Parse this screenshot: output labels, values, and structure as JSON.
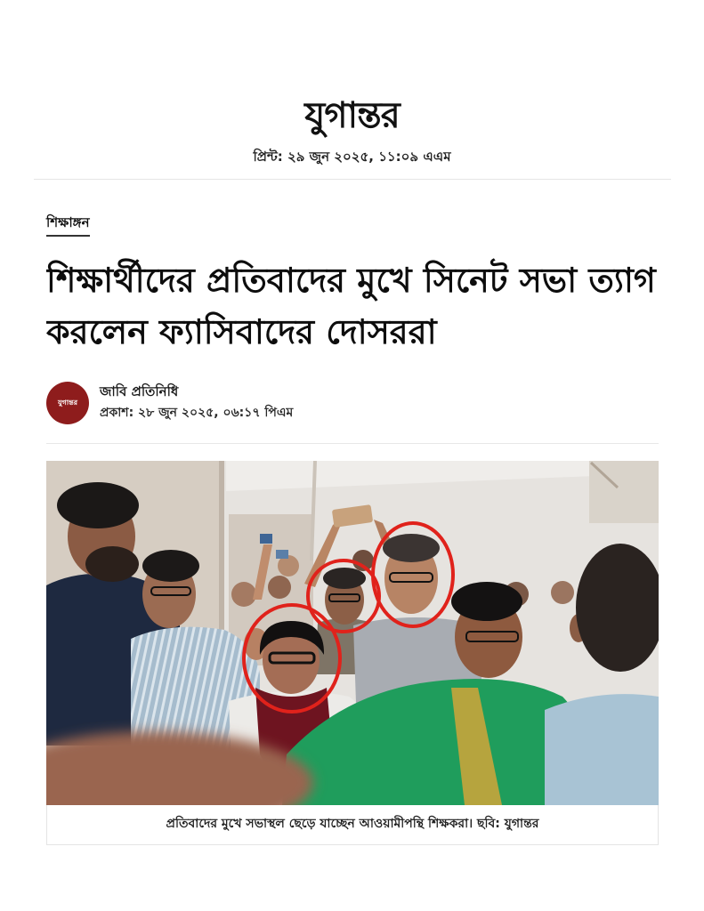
{
  "masthead": {
    "logo_text": "যুগান্তর",
    "print_timestamp": "প্রিন্ট: ২৯ জুন ২০২৫, ১১:০৯ এএম"
  },
  "article": {
    "category": "শিক্ষাঙ্গন",
    "headline": "শিক্ষার্থীদের প্রতিবাদের মুখে সিনেট সভা ত্যাগ করলেন ফ্যাসিবাদের দোসররা",
    "author": {
      "avatar_logo_text": "যুগান্তর",
      "name": "জাবি প্রতিনিধি"
    },
    "published": "প্রকাশ: ২৮ জুন ২০২৫, ০৬:১৭ পিএম",
    "image": {
      "caption": "প্রতিবাদের মুখে সভাস্থল ছেড়ে যাচ্ছেন আওয়ামীপন্থি শিক্ষকরা। ছবি: যুগান্তর",
      "annotation_color": "#e0221b"
    }
  },
  "colors": {
    "text": "#111111",
    "avatar_background": "#8e1c1c",
    "divider": "#e6e6e6"
  }
}
